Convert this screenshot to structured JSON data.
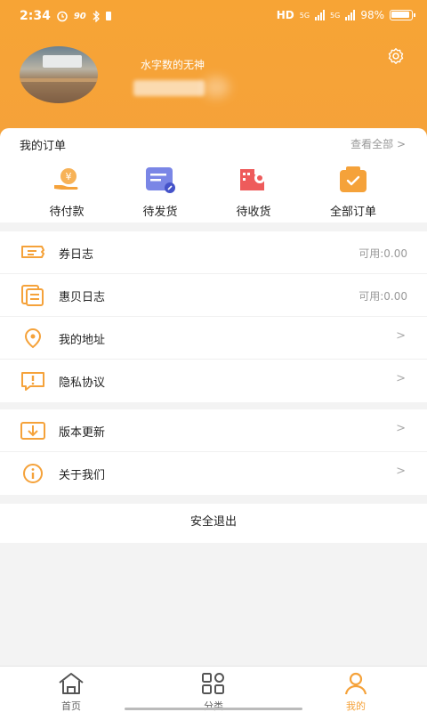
{
  "status_bar": {
    "time": "2:34",
    "network": "HD",
    "signal1": "5G",
    "signal2": "5G",
    "battery": "98%"
  },
  "profile": {
    "nickname": "水字数的无神"
  },
  "orders": {
    "title": "我的订单",
    "view_all": "查看全部 >",
    "items": [
      {
        "label": "待付款",
        "icon": "payment-icon"
      },
      {
        "label": "待发货",
        "icon": "shipping-icon"
      },
      {
        "label": "待收货",
        "icon": "receiving-icon"
      },
      {
        "label": "全部订单",
        "icon": "all-orders-icon"
      }
    ]
  },
  "menu": [
    {
      "label": "券日志",
      "value": "可用:0.00",
      "icon": "ticket-icon"
    },
    {
      "label": "惠贝日志",
      "value": "可用:0.00",
      "icon": "log-icon"
    },
    {
      "label": "我的地址",
      "value": ">",
      "icon": "location-icon"
    },
    {
      "label": "隐私协议",
      "value": ">",
      "icon": "privacy-icon"
    }
  ],
  "menu2": [
    {
      "label": "版本更新",
      "value": ">",
      "icon": "update-icon"
    },
    {
      "label": "关于我们",
      "value": ">",
      "icon": "info-icon"
    }
  ],
  "logout": "安全退出",
  "tabs": [
    {
      "label": "首页",
      "icon": "home-icon",
      "active": false
    },
    {
      "label": "分类",
      "icon": "category-icon",
      "active": false
    },
    {
      "label": "我的",
      "icon": "user-icon",
      "active": true
    }
  ],
  "colors": {
    "accent": "#f5a23a",
    "shipping": "#7a86e6",
    "receiving": "#ee5b5b"
  }
}
